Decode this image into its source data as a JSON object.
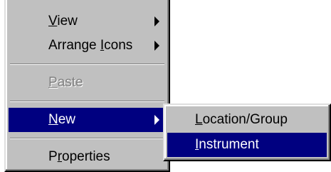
{
  "context_menu": {
    "items": [
      {
        "pre": "",
        "key": "V",
        "post": "iew",
        "has_submenu": true,
        "enabled": true
      },
      {
        "pre": "Arrange ",
        "key": "I",
        "post": "cons",
        "has_submenu": true,
        "enabled": true
      },
      {
        "pre": "",
        "key": "P",
        "post": "aste",
        "has_submenu": false,
        "enabled": false
      },
      {
        "pre": "",
        "key": "N",
        "post": "ew",
        "has_submenu": true,
        "enabled": true,
        "highlighted": true
      },
      {
        "pre": "P",
        "key": "r",
        "post": "operties",
        "has_submenu": false,
        "enabled": true
      }
    ]
  },
  "submenu_new": {
    "items": [
      {
        "pre": "",
        "key": "L",
        "post": "ocation/Group",
        "enabled": true
      },
      {
        "pre": "",
        "key": "I",
        "post": "nstrument",
        "enabled": true,
        "highlighted": true
      }
    ]
  },
  "colors": {
    "menu_face": "#c0c0c0",
    "highlight": "#000080",
    "highlight_text": "#ffffff",
    "disabled_text": "#808080"
  }
}
